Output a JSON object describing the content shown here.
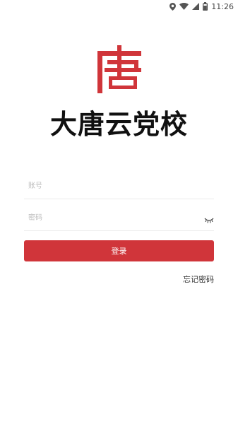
{
  "status_bar": {
    "time": "11:26",
    "icons": [
      "location-icon",
      "wifi-icon",
      "signal-icon",
      "battery-icon"
    ]
  },
  "app": {
    "title": "大唐云党校",
    "logo_glyph": "唐",
    "brand_color": "#d0353a"
  },
  "form": {
    "account_placeholder": "账号",
    "account_value": "",
    "password_placeholder": "密码",
    "password_value": "",
    "password_toggle_icon": "eye-closed-icon",
    "login_label": "登录",
    "forgot_label": "忘记密码"
  }
}
